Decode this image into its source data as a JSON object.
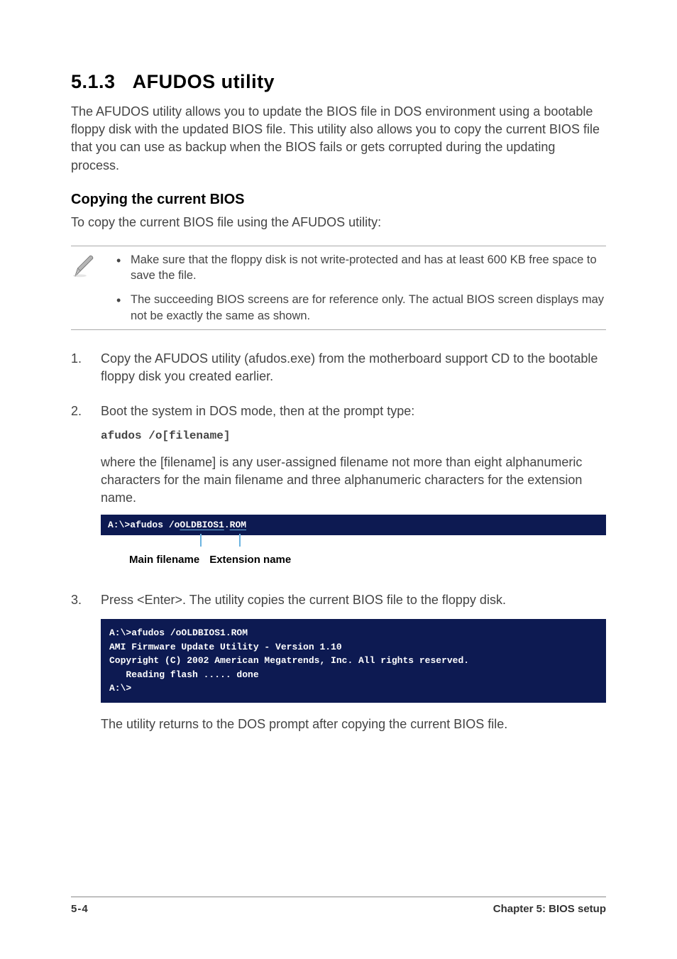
{
  "section": {
    "number": "5.1.3",
    "title": "AFUDOS utility",
    "intro": "The AFUDOS utility allows you to update the BIOS file in DOS environment using a bootable floppy disk with the updated BIOS file. This utility also allows you to copy the current BIOS file that you can use as backup when the BIOS fails or gets corrupted during the updating process."
  },
  "subsection": {
    "title": "Copying the current BIOS",
    "intro": "To copy the current BIOS file using the AFUDOS utility:"
  },
  "notes": [
    "Make sure that the floppy disk is not write-protected and has at least 600 KB free space to save the file.",
    "The succeeding BIOS screens are for reference only. The actual BIOS screen displays may not be exactly the same as shown."
  ],
  "steps": {
    "s1": {
      "num": "1.",
      "text": "Copy the AFUDOS utility (afudos.exe) from the motherboard support CD to the bootable floppy disk you created earlier."
    },
    "s2": {
      "num": "2.",
      "text": "Boot the system in DOS mode, then at the prompt type:",
      "code": "afudos /o[filename]",
      "desc": "where the [filename] is any user-assigned filename not more than eight alphanumeric characters  for the main filename and three alphanumeric characters for the extension name."
    },
    "s3": {
      "num": "3.",
      "text": "Press <Enter>. The utility copies the current BIOS file to the floppy disk.",
      "after": "The utility returns to the DOS prompt after copying the current BIOS file."
    }
  },
  "terminal1": {
    "prefix": "A:\\>afudos /o",
    "main": "OLDBIOS1",
    "dot": ".",
    "ext": "ROM"
  },
  "labels": {
    "main": "Main filename",
    "ext": "Extension name"
  },
  "terminal2": "A:\\>afudos /oOLDBIOS1.ROM\nAMI Firmware Update Utility - Version 1.10\nCopyright (C) 2002 American Megatrends, Inc. All rights reserved.\n   Reading flash ..... done\nA:\\>",
  "footer": {
    "page": "5-4",
    "chapter": "Chapter 5: BIOS setup"
  }
}
